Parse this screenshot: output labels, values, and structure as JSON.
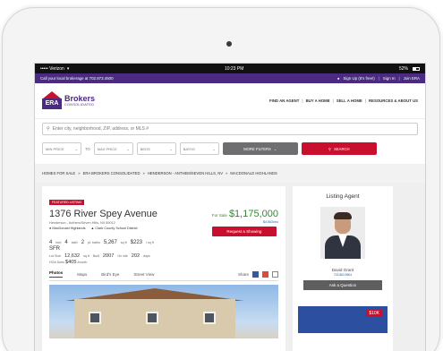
{
  "status_bar": {
    "carrier": "••••• Verizon",
    "time": "10:23 PM",
    "battery": "52%"
  },
  "top_bar": {
    "broker_text": "Call your local brokerage at 702.873.4500",
    "signup": "Sign Up (It's free!)",
    "signin": "Sign In",
    "join": "Join ERA"
  },
  "logo": {
    "mark": "ERA",
    "line1": "Brokers",
    "line2": "CONSOLIDATED"
  },
  "nav": {
    "items": [
      "FIND AN AGENT",
      "BUY A HOME",
      "SELL A HOME",
      "RESOURCES & ABOUT US"
    ]
  },
  "search": {
    "placeholder": "Enter city, neighborhood, ZIP, address, or MLS #"
  },
  "filters": {
    "min_price": "MIN PRICE",
    "to": "TO",
    "max_price": "MAX PRICE",
    "beds": "BEDS",
    "baths": "BATHS",
    "more_filters": "MORE FILTERS",
    "search_button": "SEARCH"
  },
  "breadcrumb": [
    "HOMES FOR SALE",
    "ERA BROKERS CONSOLIDATED",
    "HENDERSON - ANTHEM/SEVEN HILLS, NV",
    "MACDONALD HIGHLANDS"
  ],
  "listing": {
    "badge": "FEATURED LISTING",
    "address": "1376 River Spey Avenue",
    "subaddress": "Henderson - Anthem/Seven Hills, NV 89012",
    "neighborhood": "MacDonald Highlands",
    "school": "Clark County School District",
    "for_sale_label": "For Sale",
    "price": "$1,175,000",
    "per_month": "$4,563/mo",
    "request_button": "Request a Showing",
    "beds": "4",
    "beds_label": "bed",
    "baths": "4",
    "baths_label": "bath",
    "partial_baths": "2",
    "partial_baths_label": "pt. baths",
    "sqft": "5,267",
    "sqft_label": "sq ft",
    "price_per_sqft": "$223",
    "price_per_sqft_label": "/ sq ft",
    "type": "SFR",
    "lot_label": "Lot Size",
    "lot_size": "12,632",
    "lot_unit": "sq ft",
    "built_label": "Built",
    "built": "2007",
    "onsite_label": "On site",
    "onsite": "202",
    "onsite_unit": "days",
    "hoa_label": "HOA Dues",
    "hoa": "$405",
    "hoa_unit": "/month"
  },
  "tabs": [
    "Photos",
    "Maps",
    "Bird's Eye",
    "Street View"
  ],
  "share_label": "Share",
  "agent": {
    "heading": "Listing Agent",
    "name": "David Grant",
    "phone": "702.863.5604",
    "ask_button": "Ask a Question"
  },
  "promo_tag": "$10K"
}
